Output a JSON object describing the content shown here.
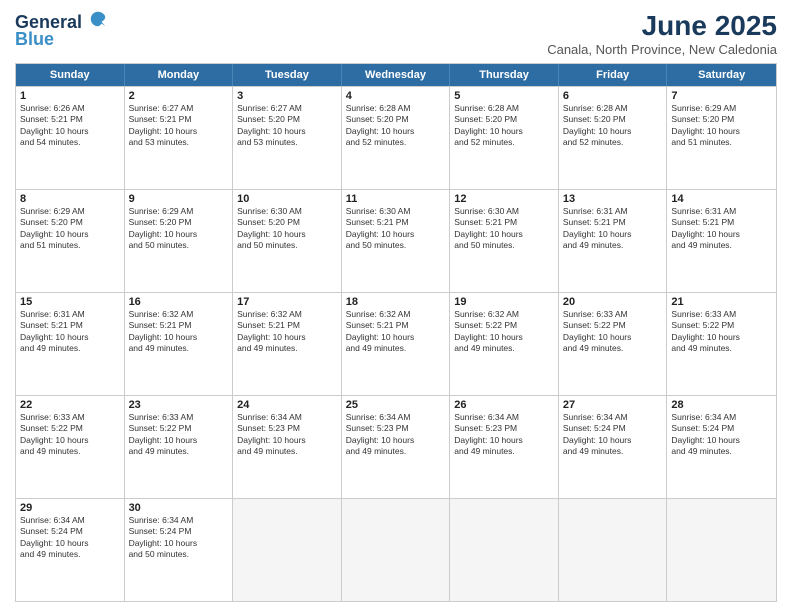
{
  "header": {
    "logo_line1": "General",
    "logo_line2": "Blue",
    "month": "June 2025",
    "location": "Canala, North Province, New Caledonia"
  },
  "weekdays": [
    "Sunday",
    "Monday",
    "Tuesday",
    "Wednesday",
    "Thursday",
    "Friday",
    "Saturday"
  ],
  "rows": [
    [
      {
        "day": "1",
        "lines": [
          "Sunrise: 6:26 AM",
          "Sunset: 5:21 PM",
          "Daylight: 10 hours",
          "and 54 minutes."
        ]
      },
      {
        "day": "2",
        "lines": [
          "Sunrise: 6:27 AM",
          "Sunset: 5:21 PM",
          "Daylight: 10 hours",
          "and 53 minutes."
        ]
      },
      {
        "day": "3",
        "lines": [
          "Sunrise: 6:27 AM",
          "Sunset: 5:20 PM",
          "Daylight: 10 hours",
          "and 53 minutes."
        ]
      },
      {
        "day": "4",
        "lines": [
          "Sunrise: 6:28 AM",
          "Sunset: 5:20 PM",
          "Daylight: 10 hours",
          "and 52 minutes."
        ]
      },
      {
        "day": "5",
        "lines": [
          "Sunrise: 6:28 AM",
          "Sunset: 5:20 PM",
          "Daylight: 10 hours",
          "and 52 minutes."
        ]
      },
      {
        "day": "6",
        "lines": [
          "Sunrise: 6:28 AM",
          "Sunset: 5:20 PM",
          "Daylight: 10 hours",
          "and 52 minutes."
        ]
      },
      {
        "day": "7",
        "lines": [
          "Sunrise: 6:29 AM",
          "Sunset: 5:20 PM",
          "Daylight: 10 hours",
          "and 51 minutes."
        ]
      }
    ],
    [
      {
        "day": "8",
        "lines": [
          "Sunrise: 6:29 AM",
          "Sunset: 5:20 PM",
          "Daylight: 10 hours",
          "and 51 minutes."
        ]
      },
      {
        "day": "9",
        "lines": [
          "Sunrise: 6:29 AM",
          "Sunset: 5:20 PM",
          "Daylight: 10 hours",
          "and 50 minutes."
        ]
      },
      {
        "day": "10",
        "lines": [
          "Sunrise: 6:30 AM",
          "Sunset: 5:20 PM",
          "Daylight: 10 hours",
          "and 50 minutes."
        ]
      },
      {
        "day": "11",
        "lines": [
          "Sunrise: 6:30 AM",
          "Sunset: 5:21 PM",
          "Daylight: 10 hours",
          "and 50 minutes."
        ]
      },
      {
        "day": "12",
        "lines": [
          "Sunrise: 6:30 AM",
          "Sunset: 5:21 PM",
          "Daylight: 10 hours",
          "and 50 minutes."
        ]
      },
      {
        "day": "13",
        "lines": [
          "Sunrise: 6:31 AM",
          "Sunset: 5:21 PM",
          "Daylight: 10 hours",
          "and 49 minutes."
        ]
      },
      {
        "day": "14",
        "lines": [
          "Sunrise: 6:31 AM",
          "Sunset: 5:21 PM",
          "Daylight: 10 hours",
          "and 49 minutes."
        ]
      }
    ],
    [
      {
        "day": "15",
        "lines": [
          "Sunrise: 6:31 AM",
          "Sunset: 5:21 PM",
          "Daylight: 10 hours",
          "and 49 minutes."
        ]
      },
      {
        "day": "16",
        "lines": [
          "Sunrise: 6:32 AM",
          "Sunset: 5:21 PM",
          "Daylight: 10 hours",
          "and 49 minutes."
        ]
      },
      {
        "day": "17",
        "lines": [
          "Sunrise: 6:32 AM",
          "Sunset: 5:21 PM",
          "Daylight: 10 hours",
          "and 49 minutes."
        ]
      },
      {
        "day": "18",
        "lines": [
          "Sunrise: 6:32 AM",
          "Sunset: 5:21 PM",
          "Daylight: 10 hours",
          "and 49 minutes."
        ]
      },
      {
        "day": "19",
        "lines": [
          "Sunrise: 6:32 AM",
          "Sunset: 5:22 PM",
          "Daylight: 10 hours",
          "and 49 minutes."
        ]
      },
      {
        "day": "20",
        "lines": [
          "Sunrise: 6:33 AM",
          "Sunset: 5:22 PM",
          "Daylight: 10 hours",
          "and 49 minutes."
        ]
      },
      {
        "day": "21",
        "lines": [
          "Sunrise: 6:33 AM",
          "Sunset: 5:22 PM",
          "Daylight: 10 hours",
          "and 49 minutes."
        ]
      }
    ],
    [
      {
        "day": "22",
        "lines": [
          "Sunrise: 6:33 AM",
          "Sunset: 5:22 PM",
          "Daylight: 10 hours",
          "and 49 minutes."
        ]
      },
      {
        "day": "23",
        "lines": [
          "Sunrise: 6:33 AM",
          "Sunset: 5:22 PM",
          "Daylight: 10 hours",
          "and 49 minutes."
        ]
      },
      {
        "day": "24",
        "lines": [
          "Sunrise: 6:34 AM",
          "Sunset: 5:23 PM",
          "Daylight: 10 hours",
          "and 49 minutes."
        ]
      },
      {
        "day": "25",
        "lines": [
          "Sunrise: 6:34 AM",
          "Sunset: 5:23 PM",
          "Daylight: 10 hours",
          "and 49 minutes."
        ]
      },
      {
        "day": "26",
        "lines": [
          "Sunrise: 6:34 AM",
          "Sunset: 5:23 PM",
          "Daylight: 10 hours",
          "and 49 minutes."
        ]
      },
      {
        "day": "27",
        "lines": [
          "Sunrise: 6:34 AM",
          "Sunset: 5:24 PM",
          "Daylight: 10 hours",
          "and 49 minutes."
        ]
      },
      {
        "day": "28",
        "lines": [
          "Sunrise: 6:34 AM",
          "Sunset: 5:24 PM",
          "Daylight: 10 hours",
          "and 49 minutes."
        ]
      }
    ],
    [
      {
        "day": "29",
        "lines": [
          "Sunrise: 6:34 AM",
          "Sunset: 5:24 PM",
          "Daylight: 10 hours",
          "and 49 minutes."
        ]
      },
      {
        "day": "30",
        "lines": [
          "Sunrise: 6:34 AM",
          "Sunset: 5:24 PM",
          "Daylight: 10 hours",
          "and 50 minutes."
        ]
      },
      {
        "day": "",
        "lines": []
      },
      {
        "day": "",
        "lines": []
      },
      {
        "day": "",
        "lines": []
      },
      {
        "day": "",
        "lines": []
      },
      {
        "day": "",
        "lines": []
      }
    ]
  ]
}
